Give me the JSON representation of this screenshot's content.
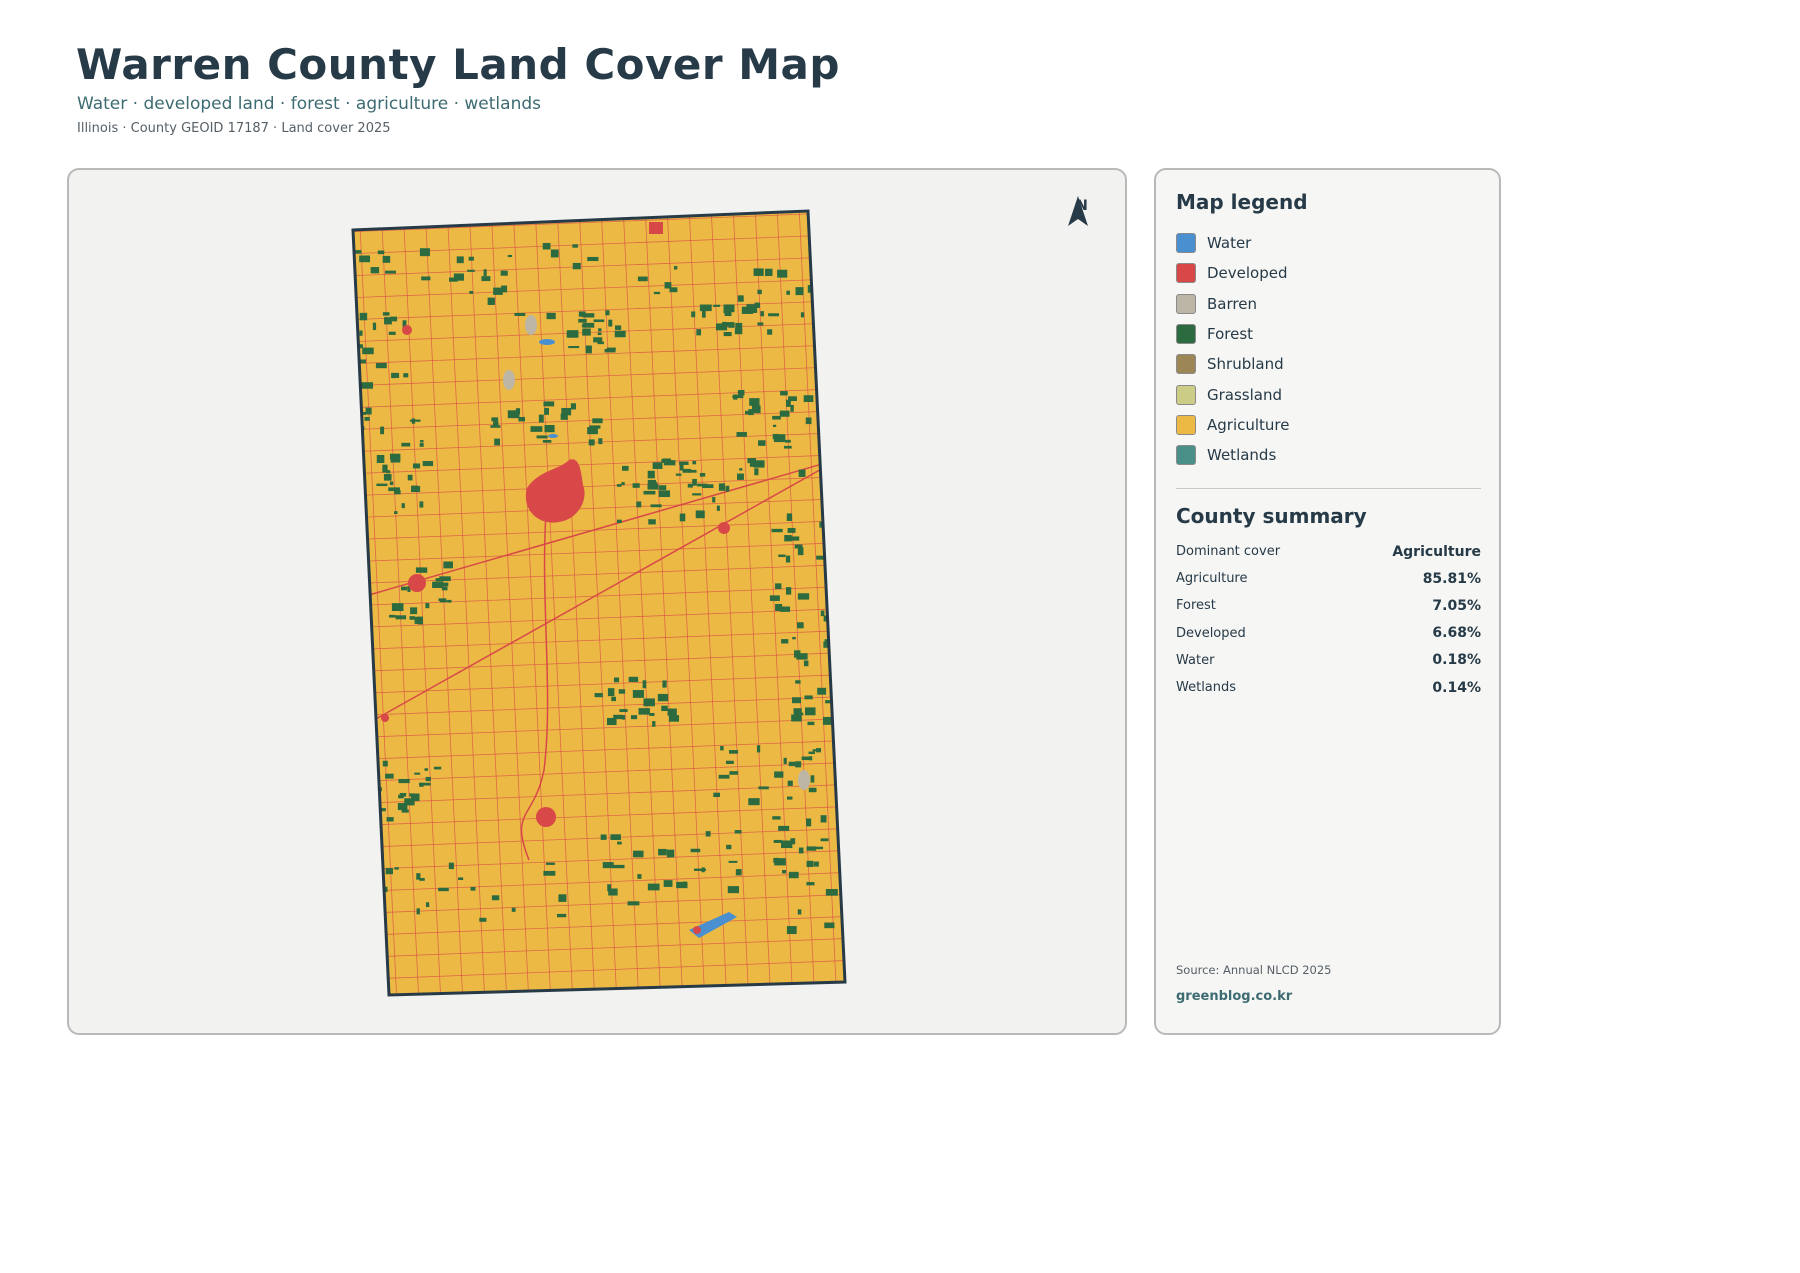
{
  "header": {
    "title": "Warren County Land Cover Map",
    "subtitle": "Water · developed land · forest · agriculture · wetlands",
    "meta": "Illinois · County GEOID 17187 · Land cover 2025"
  },
  "map": {
    "north_label": "N",
    "north_icon": "north-arrow-icon",
    "colors": {
      "water": "#4a90d0",
      "developed": "#d84848",
      "barren": "#bdb6a6",
      "forest": "#2c6b40",
      "shrubland": "#9c8655",
      "grassland": "#cbcd86",
      "agriculture": "#ecb944",
      "wetlands": "#4a8f88",
      "county_outline": "#263a47"
    }
  },
  "legend": {
    "heading": "Map legend",
    "items": [
      {
        "label": "Water",
        "color": "#4a90d0"
      },
      {
        "label": "Developed",
        "color": "#d84848"
      },
      {
        "label": "Barren",
        "color": "#bdb6a6"
      },
      {
        "label": "Forest",
        "color": "#2c6b40"
      },
      {
        "label": "Shrubland",
        "color": "#9c8655"
      },
      {
        "label": "Grassland",
        "color": "#cbcd86"
      },
      {
        "label": "Agriculture",
        "color": "#ecb944"
      },
      {
        "label": "Wetlands",
        "color": "#4a8f88"
      }
    ]
  },
  "summary": {
    "heading": "County summary",
    "rows": [
      {
        "key": "Dominant cover",
        "value": "Agriculture"
      },
      {
        "key": "Agriculture",
        "value": "85.81%"
      },
      {
        "key": "Forest",
        "value": "7.05%"
      },
      {
        "key": "Developed",
        "value": "6.68%"
      },
      {
        "key": "Water",
        "value": "0.18%"
      },
      {
        "key": "Wetlands",
        "value": "0.14%"
      }
    ]
  },
  "footer": {
    "source": "Source: Annual NLCD 2025",
    "site": "greenblog.co.kr"
  }
}
